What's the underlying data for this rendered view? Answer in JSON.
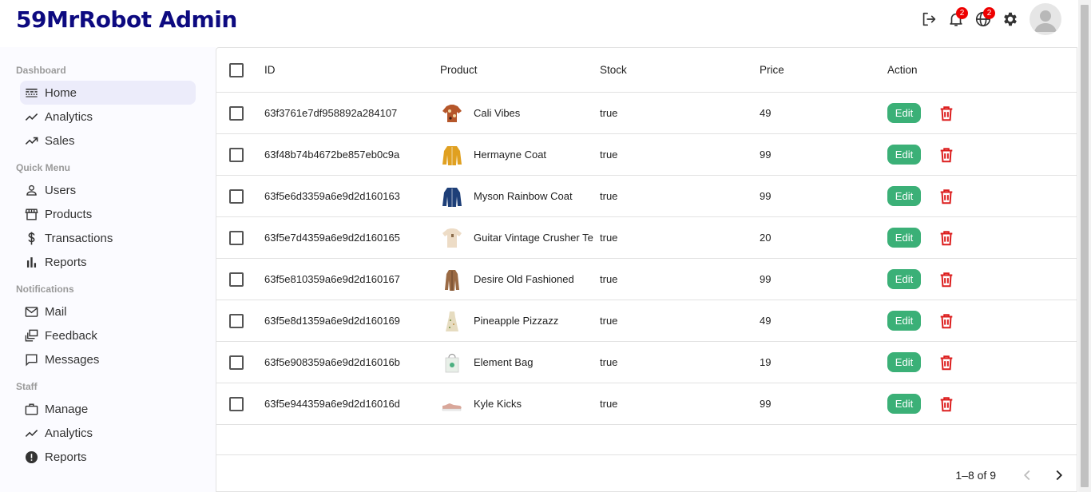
{
  "app": {
    "title": "59MrRobot Admin"
  },
  "header": {
    "notifications_badge": "2",
    "language_badge": "2"
  },
  "sidebar": {
    "sections": [
      {
        "title": "Dashboard",
        "items": [
          {
            "label": "Home",
            "icon": "line-style-icon",
            "active": true
          },
          {
            "label": "Analytics",
            "icon": "timeline-icon"
          },
          {
            "label": "Sales",
            "icon": "trending-up-icon"
          }
        ]
      },
      {
        "title": "Quick Menu",
        "items": [
          {
            "label": "Users",
            "icon": "person-outline-icon"
          },
          {
            "label": "Products",
            "icon": "storefront-icon"
          },
          {
            "label": "Transactions",
            "icon": "dollar-icon"
          },
          {
            "label": "Reports",
            "icon": "bar-chart-icon"
          }
        ]
      },
      {
        "title": "Notifications",
        "items": [
          {
            "label": "Mail",
            "icon": "mail-outline-icon"
          },
          {
            "label": "Feedback",
            "icon": "dynamic-feed-icon"
          },
          {
            "label": "Messages",
            "icon": "chat-bubble-outline-icon"
          }
        ]
      },
      {
        "title": "Staff",
        "items": [
          {
            "label": "Manage",
            "icon": "work-outline-icon"
          },
          {
            "label": "Analytics",
            "icon": "timeline-icon"
          },
          {
            "label": "Reports",
            "icon": "report-icon"
          }
        ]
      }
    ]
  },
  "table": {
    "columns": {
      "id": "ID",
      "product": "Product",
      "stock": "Stock",
      "price": "Price",
      "action": "Action"
    },
    "edit_label": "Edit",
    "rows": [
      {
        "id": "63f3761e7df958892a284107",
        "product": "Cali Vibes",
        "stock": "true",
        "price": "49",
        "thumb": "shirt",
        "color": "#b5562a"
      },
      {
        "id": "63f48b74b4672be857eb0c9a",
        "product": "Hermayne Coat",
        "stock": "true",
        "price": "99",
        "thumb": "coat",
        "color": "#e0a020"
      },
      {
        "id": "63f5e6d3359a6e9d2d160163",
        "product": "Myson Rainbow Coat",
        "stock": "true",
        "price": "99",
        "thumb": "coat",
        "color": "#1e3f78"
      },
      {
        "id": "63f5e7d4359a6e9d2d160165",
        "product": "Guitar Vintage Crusher Tee",
        "stock": "true",
        "price": "20",
        "thumb": "tee",
        "color": "#eddcc6"
      },
      {
        "id": "63f5e810359a6e9d2d160167",
        "product": "Desire Old Fashioned",
        "stock": "true",
        "price": "99",
        "thumb": "longcoat",
        "color": "#9a6a44"
      },
      {
        "id": "63f5e8d1359a6e9d2d160169",
        "product": "Pineapple Pizzazz",
        "stock": "true",
        "price": "49",
        "thumb": "dress",
        "color": "#e6dcc0"
      },
      {
        "id": "63f5e908359a6e9d2d16016b",
        "product": "Element Bag",
        "stock": "true",
        "price": "19",
        "thumb": "bag",
        "color": "#e8efe8"
      },
      {
        "id": "63f5e944359a6e9d2d16016d",
        "product": "Kyle Kicks",
        "stock": "true",
        "price": "99",
        "thumb": "shoe",
        "color": "#d9a79a"
      }
    ]
  },
  "pagination": {
    "label": "1–8 of 9"
  },
  "colors": {
    "brand": "#0d0a80",
    "edit": "#3bb077",
    "delete": "#dc1e1e",
    "active_nav": "#ececfa"
  }
}
